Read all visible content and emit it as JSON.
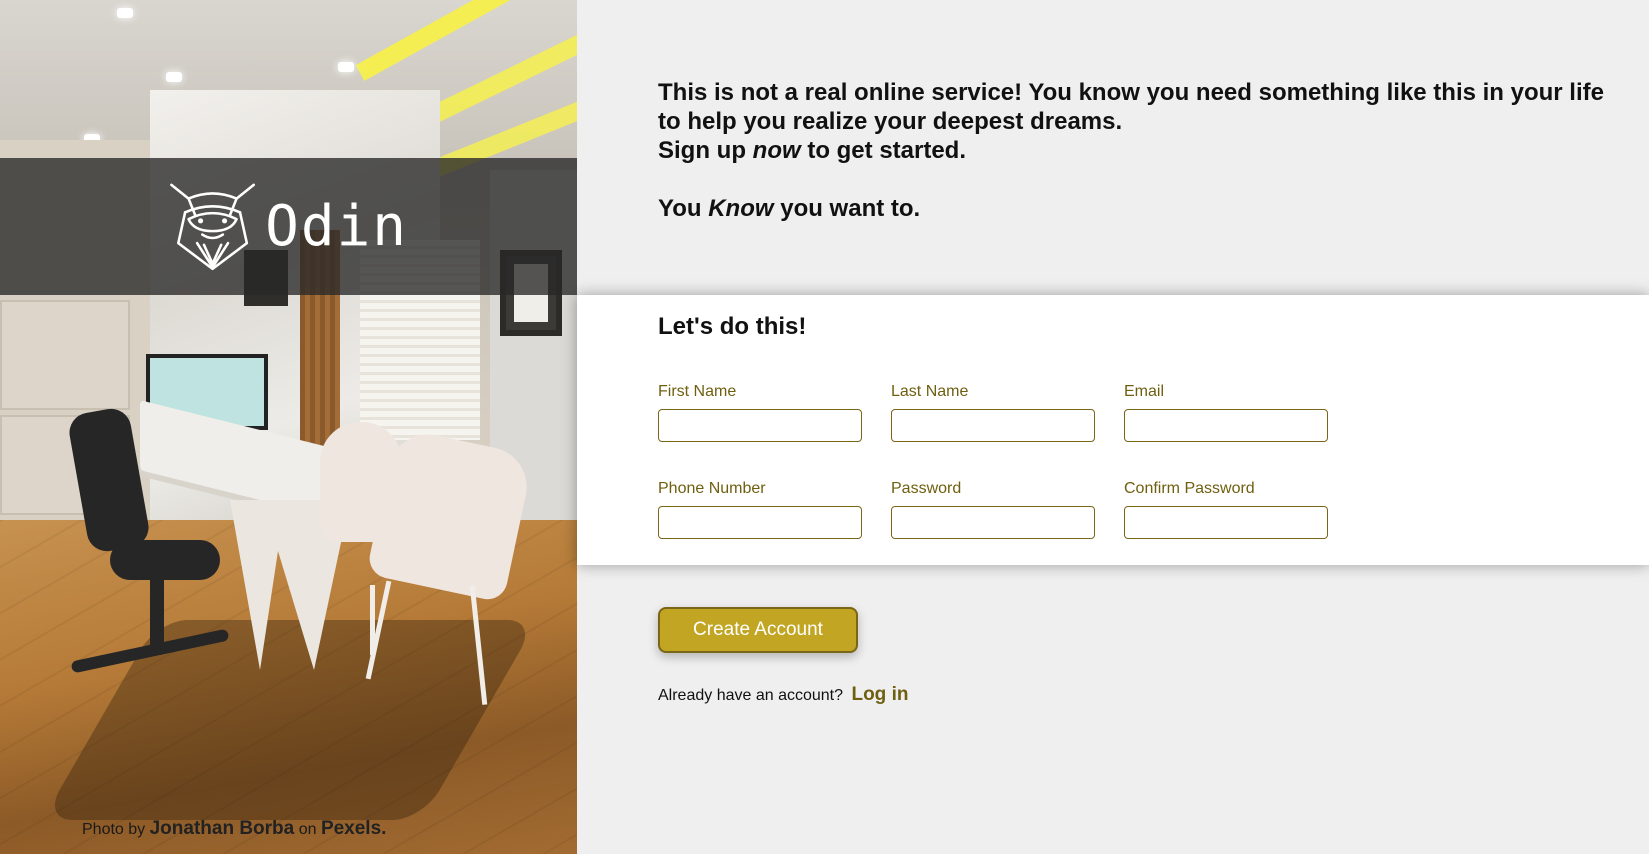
{
  "brand": {
    "name": "Odin"
  },
  "photo_credit": {
    "prefix": "Photo by",
    "author": "Jonathan Borba",
    "middle": "on",
    "site": "Pexels."
  },
  "intro": {
    "line1": "This is not a real online service! You know you need something like this in your life",
    "line2": "to help you realize your deepest dreams.",
    "line3_a": "Sign up ",
    "line3_em": "now",
    "line3_b": " to get started.",
    "line4_a": "You ",
    "line4_em": "Know",
    "line4_b": " you want to."
  },
  "form": {
    "title": "Let's do this!",
    "fields": [
      {
        "label": "First Name",
        "value": ""
      },
      {
        "label": "Last Name",
        "value": ""
      },
      {
        "label": "Email",
        "value": ""
      },
      {
        "label": "Phone Number",
        "value": ""
      },
      {
        "label": "Password",
        "value": ""
      },
      {
        "label": "Confirm Password",
        "value": ""
      }
    ]
  },
  "actions": {
    "create_label": "Create Account",
    "login_prompt": "Already have an account?",
    "login_label": "Log in"
  },
  "colors": {
    "accent": "#c2a623",
    "accent_dark": "#6f5f10",
    "background": "#efefef"
  }
}
